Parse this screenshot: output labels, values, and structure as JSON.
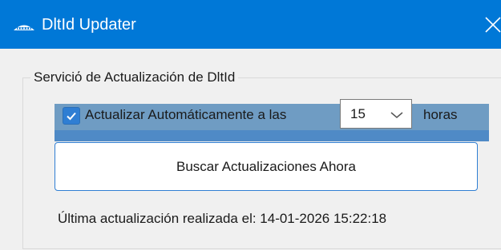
{
  "window": {
    "title": "DltId Updater",
    "icon": "app-logo-icon",
    "close_icon": "close-icon"
  },
  "group": {
    "legend": "Serviciό de Actualización de DltId"
  },
  "auto_update": {
    "checked": true,
    "label": "Actualizar Automáticamente a las",
    "hour_value": "15",
    "hours_label": "horas"
  },
  "search_button": {
    "label": "Buscar Actualizaciones Ahora"
  },
  "status": {
    "last_update_text": "Última actualización realizada el: 14-01-2026 15:22:18"
  },
  "colors": {
    "titlebar": "#0078d7",
    "accent": "#2f7ed3",
    "highlight": "#6f9cc3",
    "window_bg": "#f0f0f0"
  }
}
